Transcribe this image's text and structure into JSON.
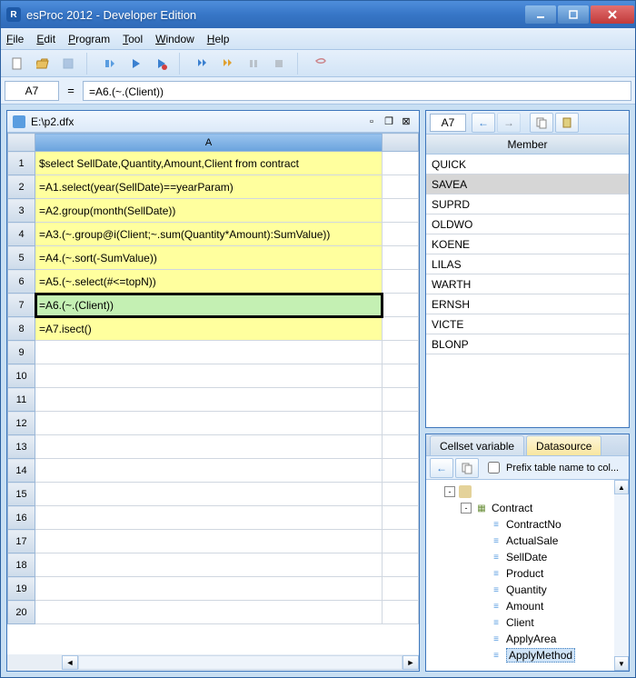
{
  "title": "esProc 2012 - Developer Edition",
  "menus": {
    "file": "File",
    "edit": "Edit",
    "program": "Program",
    "tool": "Tool",
    "window": "Window",
    "help": "Help"
  },
  "formula": {
    "cellref": "A7",
    "eq": "=",
    "text": "=A6.(~.(Client))"
  },
  "doc": {
    "path": "E:\\p2.dfx"
  },
  "colA": "A",
  "rows": [
    {
      "n": "1",
      "code": "$select SellDate,Quantity,Amount,Client from contract"
    },
    {
      "n": "2",
      "code": "=A1.select(year(SellDate)==yearParam)"
    },
    {
      "n": "3",
      "code": "=A2.group(month(SellDate))"
    },
    {
      "n": "4",
      "code": "=A3.(~.group@i(Client;~.sum(Quantity*Amount):SumValue))"
    },
    {
      "n": "5",
      "code": "=A4.(~.sort(-SumValue))"
    },
    {
      "n": "6",
      "code": "=A5.(~.select(#<=topN))"
    },
    {
      "n": "7",
      "code": "=A6.(~.(Client))"
    },
    {
      "n": "8",
      "code": "=A7.isect()"
    },
    {
      "n": "9",
      "code": ""
    },
    {
      "n": "10",
      "code": ""
    },
    {
      "n": "11",
      "code": ""
    },
    {
      "n": "12",
      "code": ""
    },
    {
      "n": "13",
      "code": ""
    },
    {
      "n": "14",
      "code": ""
    },
    {
      "n": "15",
      "code": ""
    },
    {
      "n": "16",
      "code": ""
    },
    {
      "n": "17",
      "code": ""
    },
    {
      "n": "18",
      "code": ""
    },
    {
      "n": "19",
      "code": ""
    },
    {
      "n": "20",
      "code": ""
    }
  ],
  "right": {
    "cellref": "A7",
    "memberhead": "Member",
    "members": [
      "QUICK",
      "SAVEA",
      "SUPRD",
      "OLDWO",
      "KOENE",
      "LILAS",
      "WARTH",
      "ERNSH",
      "VICTE",
      "BLONP"
    ],
    "selected": "SAVEA"
  },
  "tabs": {
    "cellset": "Cellset variable",
    "datasource": "Datasource"
  },
  "ds": {
    "prefix_label": "Prefix table name to col...",
    "table": "Contract",
    "fields": [
      "ContractNo",
      "ActualSale",
      "SellDate",
      "Product",
      "Quantity",
      "Amount",
      "Client",
      "ApplyArea",
      "ApplyMethod"
    ],
    "selected_field": "ApplyMethod"
  }
}
